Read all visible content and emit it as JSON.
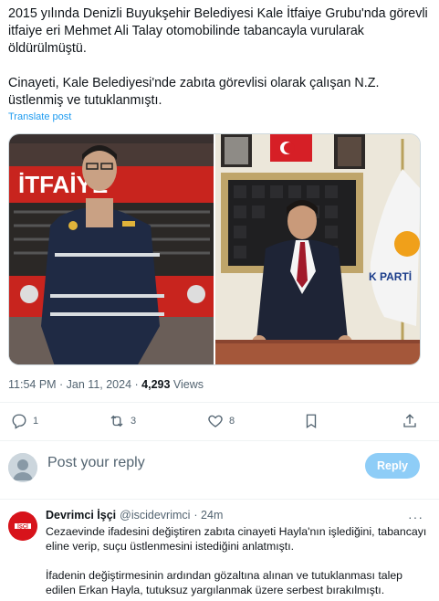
{
  "post": {
    "paragraph1": "2015 yılında Denizli Buyukşehir Belediyesi Kale İtfaiye Grubu'nda görevli itfaiye eri Mehmet Ali Talay otomobilinde tabancayla vurularak öldürülmüştü.",
    "paragraph2": "Cinayeti, Kale Belediyesi'nde zabıta görevlisi olarak çalışan N.Z. üstlenmiş ve tutuklanmıştı.",
    "translate": "Translate post",
    "image1_sign": "İTFAİYE",
    "image2_sign": "K PARTİ",
    "time": "11:54 PM · Jan 11, 2024 · ",
    "views_count": "4,293",
    "views_label": " Views"
  },
  "actions": {
    "replies": "1",
    "reposts": "3",
    "likes": "8"
  },
  "reply_box": {
    "placeholder": "Post your reply",
    "button": "Reply"
  },
  "reply": {
    "name": "Devrimci İşçi",
    "handle": "@iscidevrimci",
    "time": "· 24m",
    "more": "···",
    "avatar_text": "İŞÇİ",
    "paragraph1": "Cezaevinde ifadesini değiştiren zabıta cinayeti Hayla'nın işlediğini, tabancayı eline verip, suçu üstlenmesini istediğini anlatmıştı.",
    "paragraph2": "İfadenin değiştirmesinin ardından gözaltına alınan ve tutuklanması talep edilen Erkan Hayla, tutuksuz yargılanmak üzere serbest bırakılmıştı."
  },
  "colors": {
    "accent": "#1d9bf0",
    "reply_button": "#8ecdf7",
    "avatar_red": "#d7131b"
  }
}
